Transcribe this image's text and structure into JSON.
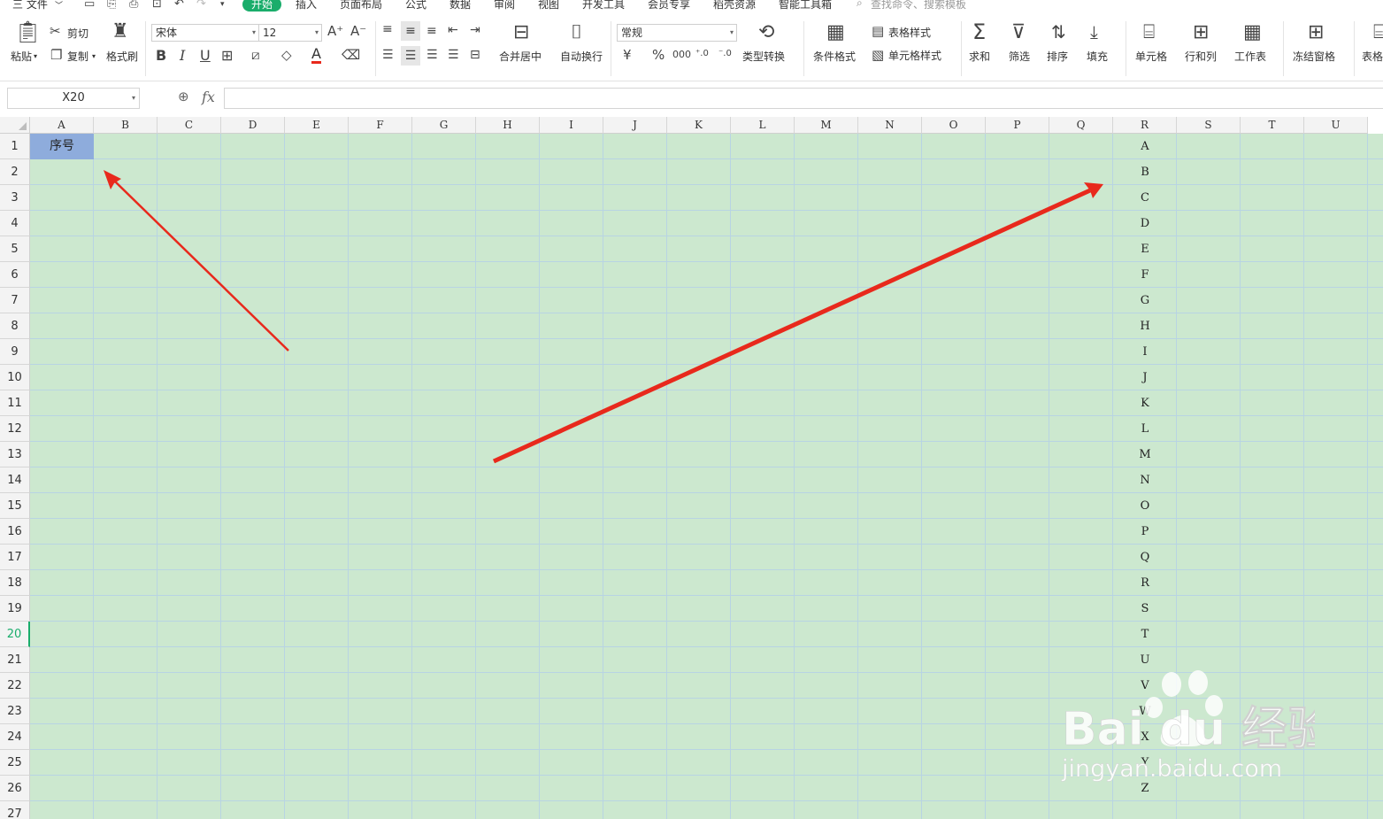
{
  "menu": {
    "file": "三 文件",
    "tabs": [
      "开始",
      "插入",
      "页面布局",
      "公式",
      "数据",
      "审阅",
      "视图",
      "开发工具",
      "会员专享",
      "稻壳资源",
      "智能工具箱"
    ],
    "search_placeholder": "查找命令、搜索模板"
  },
  "ribbon": {
    "paste": "粘贴",
    "cut": "剪切",
    "copy": "复制",
    "format_painter": "格式刷",
    "font_name": "宋体",
    "font_size": "12",
    "merge_center": "合并居中",
    "wrap_text": "自动换行",
    "number_format": "常规",
    "currency": "¥",
    "percent": "%",
    "type_convert": "类型转换",
    "conditional_format": "条件格式",
    "table_style": "表格样式",
    "cell_style": "单元格样式",
    "sum": "求和",
    "filter": "筛选",
    "sort": "排序",
    "fill": "填充",
    "cells": "单元格",
    "rows_cols": "行和列",
    "worksheet": "工作表",
    "freeze": "冻结窗格",
    "table_tools": "表格"
  },
  "formula_bar": {
    "name_box": "X20",
    "fx": "fx",
    "value": ""
  },
  "sheet": {
    "columns": [
      "A",
      "B",
      "C",
      "D",
      "E",
      "F",
      "G",
      "H",
      "I",
      "J",
      "K",
      "L",
      "M",
      "N",
      "O",
      "P",
      "Q",
      "R",
      "S",
      "T",
      "U"
    ],
    "rows": [
      "1",
      "2",
      "3",
      "4",
      "5",
      "6",
      "7",
      "8",
      "9",
      "10",
      "11",
      "12",
      "13",
      "14",
      "15",
      "16",
      "17",
      "18",
      "19",
      "20",
      "21",
      "22",
      "23",
      "24",
      "25",
      "26",
      "27"
    ],
    "selected_row": "20",
    "a1_value": "序号",
    "column_r_values": [
      "A",
      "B",
      "C",
      "D",
      "E",
      "F",
      "G",
      "H",
      "I",
      "J",
      "K",
      "L",
      "M",
      "N",
      "O",
      "P",
      "Q",
      "R",
      "S",
      "T",
      "U",
      "V",
      "W",
      "X",
      "Y",
      "Z"
    ]
  },
  "watermark": {
    "brand": "Bai du 经验",
    "url": "jingyan.baidu.com"
  },
  "colors": {
    "accent": "#1aad6b",
    "grid_bg": "#cce8cf",
    "a1_fill": "#8eacdc",
    "arrow": "#e8291c"
  }
}
